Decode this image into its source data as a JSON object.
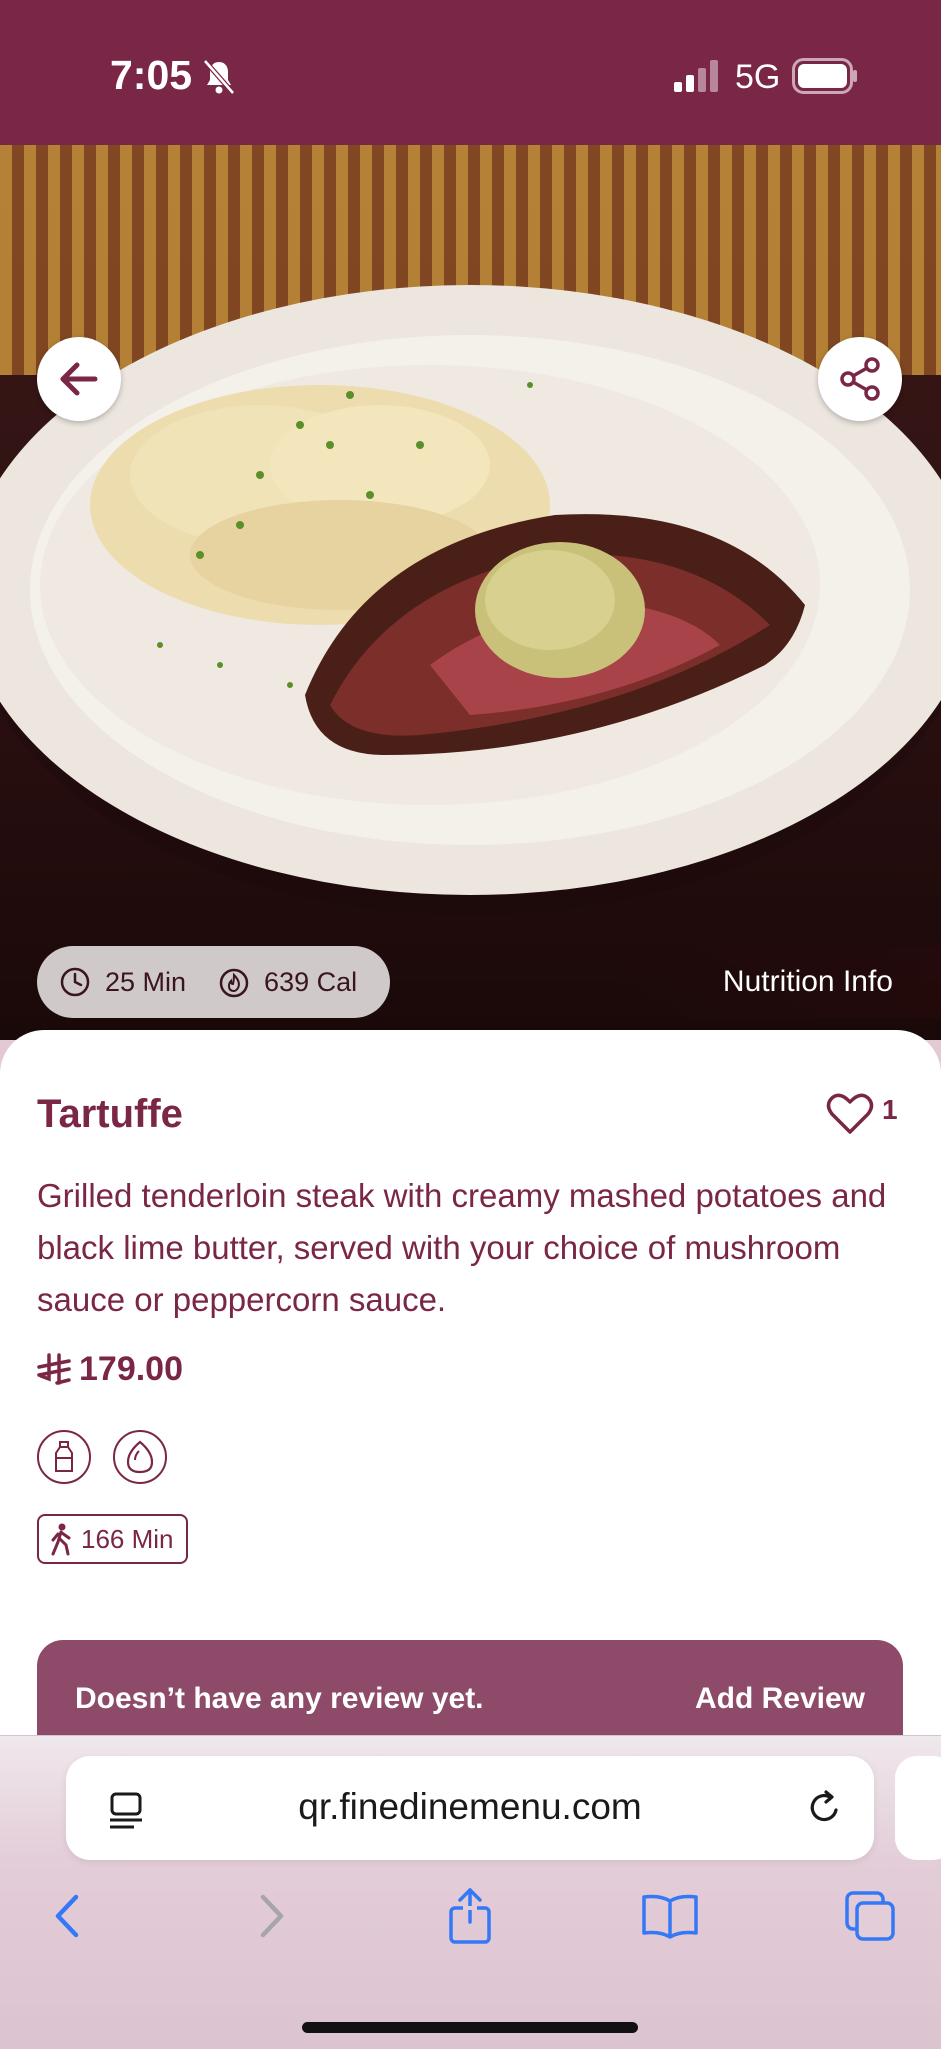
{
  "status_bar": {
    "time": "7:05",
    "network": "5G",
    "icons": [
      "bell-slash-icon",
      "signal-icon",
      "battery-icon"
    ]
  },
  "hero": {
    "image_alt": "Grilled tenderloin steak with mashed potatoes on a white plate",
    "buttons": [
      "back-arrow-icon",
      "share-icon"
    ],
    "chips": {
      "time_label": "25 Min",
      "calories_label": "639 Cal"
    },
    "nutrition_link": "Nutrition Info"
  },
  "dish": {
    "title": "Tartuffe",
    "likes": "1",
    "description": "Grilled tenderloin steak with creamy mashed potatoes and black lime butter, served with your choice of mushroom sauce or peppercorn sauce.",
    "price": "179.00",
    "allergens": [
      "milk-icon",
      "egg-icon"
    ],
    "walk_time": "166 Min"
  },
  "reviews": {
    "empty_text": "Doesn’t have any review yet.",
    "add_label": "Add Review"
  },
  "browser": {
    "url": "qr.finedinemenu.com",
    "toolbar": [
      "back-icon",
      "forward-icon",
      "share-icon",
      "bookmarks-icon",
      "tabs-icon"
    ]
  },
  "colors": {
    "brand": "#7a2647",
    "review_bar": "#8e4b69",
    "ios_blue": "#3478f6"
  }
}
